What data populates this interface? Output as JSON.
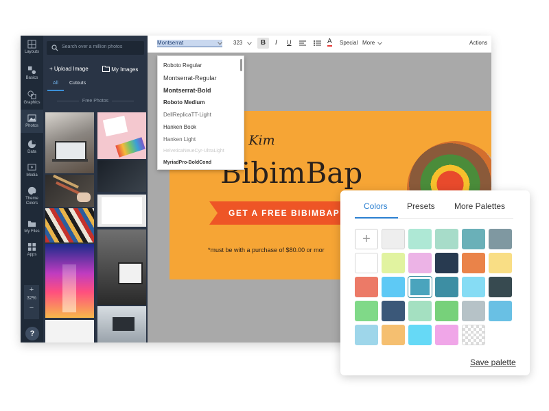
{
  "rail": [
    {
      "label": "Layouts",
      "icon": "layout-icon"
    },
    {
      "label": "Basics",
      "icon": "text-icon"
    },
    {
      "label": "Graphics",
      "icon": "shapes-icon"
    },
    {
      "label": "Photos",
      "icon": "photo-icon"
    },
    {
      "label": "Data",
      "icon": "chart-icon"
    },
    {
      "label": "Media",
      "icon": "media-icon"
    },
    {
      "label": "Theme Colors",
      "icon": "palette-icon"
    },
    {
      "label": "My Files",
      "icon": "folder-icon"
    },
    {
      "label": "Apps",
      "icon": "apps-icon"
    }
  ],
  "zoom": {
    "value": "32%",
    "plus": "+",
    "minus": "−"
  },
  "help": "?",
  "panel": {
    "search_placeholder": "Search over a million photos",
    "upload": "+ Upload Image",
    "my_images": "My Images",
    "tab_all": "All",
    "tab_cutouts": "Cutouts",
    "section": "Free Photos"
  },
  "toolbar": {
    "font": "Montserrat",
    "size": "323",
    "bold": "B",
    "italic": "I",
    "underline": "U",
    "special": "Special",
    "more": "More",
    "actions": "Actions",
    "color_a": "A"
  },
  "fonts": [
    "Roboto Regular",
    "Montserrat-Regular",
    "Montserrat-Bold",
    "Roboto Medium",
    "DellReplicaTT-Light",
    "Hanken Book",
    "Hanken Light",
    "HelveticaNeueCyr-UltraLight",
    "MyriadPro-BoldCond"
  ],
  "design": {
    "script": "el Kim",
    "headline": "BibimBap",
    "banner": "GET A FREE BIBIMBAP",
    "fine": "*must be with a purchase of $80.00 or mor"
  },
  "palette": {
    "tabs": [
      "Colors",
      "Presets",
      "More Palettes"
    ],
    "add": "+",
    "save": "Save palette",
    "swatches": [
      [
        "add",
        "#eeeeee",
        "#aee8d5",
        "#a7dcc9",
        "#6ab0b8",
        "#7f98a1"
      ],
      [
        "#ffffff",
        "#e1f3a0",
        "#ecb3e6",
        "#283a50",
        "#ea8349",
        "#f9de85"
      ],
      [
        "#ec7a67",
        "#5ec9f5",
        "#4aa4bd",
        "#3d8ea3",
        "#86dcf4",
        "#374a50"
      ],
      [
        "#80d988",
        "#3b5879",
        "#a4e0c1",
        "#77d17a",
        "#b6c2c7",
        "#69c0e4"
      ],
      [
        "#9ed6ea",
        "#f5bf70",
        "#66d9f6",
        "#f0a6e8",
        "transparent"
      ]
    ]
  }
}
